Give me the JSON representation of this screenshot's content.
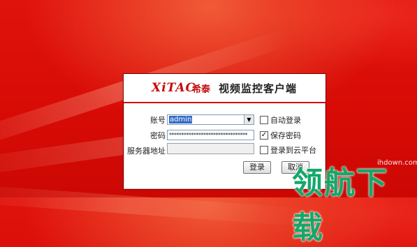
{
  "header": {
    "brand_logo": "XiTAC",
    "brand_cn": "希泰",
    "app_title": "视频监控客户端"
  },
  "form": {
    "account_label": "账号",
    "account_value": "admin",
    "password_label": "密码",
    "password_mask": "********************************",
    "server_label": "服务器地址",
    "server_value": ""
  },
  "options": {
    "auto_login": {
      "label": "自动登录",
      "checked": false
    },
    "save_password": {
      "label": "保存密码",
      "checked": true
    },
    "cloud_login": {
      "label": "登录到云平台",
      "checked": false
    }
  },
  "buttons": {
    "login": "登录",
    "cancel": "取消"
  },
  "watermark": {
    "site": "ihdown.com",
    "text": "领航下载"
  },
  "glyphs": {
    "dropdown": "▼",
    "check": "✓"
  },
  "colors": {
    "background": "#d80b06",
    "brand_red": "#c30c0c",
    "watermark_green": "#13a86a"
  }
}
